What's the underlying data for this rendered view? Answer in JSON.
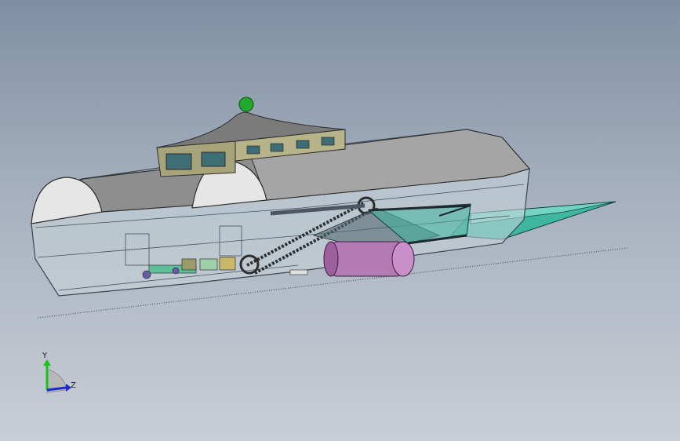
{
  "viewport": {
    "background_top": "#7f8fa3",
    "background_bottom": "#c9ced6"
  },
  "model": {
    "hull_color": "#c9d6db",
    "roof_color": "#8e8e8e",
    "cabin_color": "#a7a37a",
    "beacon_color": "#1faa2e",
    "roller_color": "#b47ab4",
    "blade_color": "#3fb7a0"
  },
  "triad": {
    "y_label": "Y",
    "z_label": "Z",
    "y_color": "#19c319",
    "z_color": "#1a2bd6"
  }
}
